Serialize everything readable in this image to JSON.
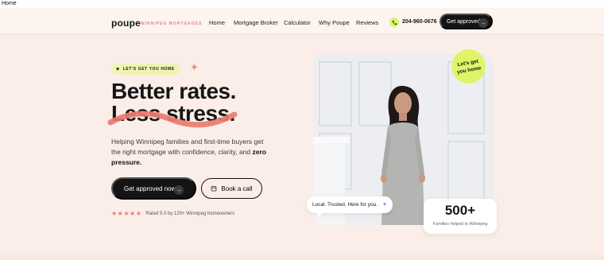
{
  "window": {
    "tab_title": "Home"
  },
  "brand": {
    "name": "poupe",
    "tagline": "WINNIPEG MORTGAGES"
  },
  "nav": {
    "links": [
      "Home",
      "Mortgage Broker",
      "Calculator",
      "Why Poupe",
      "Reviews"
    ],
    "phone": "204-960-0676",
    "cta_label": "Get approved"
  },
  "hero": {
    "eyebrow": "LET'S GET YOU HOME",
    "headline_line1": "Better rates.",
    "headline_line2": "Less stress.",
    "lede": "Helping Winnipeg families and first-time buyers get the right mortgage with confidence, clarity, and",
    "lede_bold": "zero pressure.",
    "primary_cta": "Get approved now",
    "secondary_cta": "Book a call",
    "stars": "★★★★★",
    "rating_text": "Rated 5.0 by 120+ Winnipeg homeowners"
  },
  "photo_card": {
    "badge_line1": "Let's get",
    "badge_line2": "you home",
    "chip_text": "Local. Trusted. Here for you.",
    "stat_value": "500+",
    "stat_label": "Families helped in Winnipeg"
  },
  "colors": {
    "background": "#fbeee8",
    "accent_lime": "#def567",
    "accent_coral": "#ea7b70",
    "dark": "#141414"
  },
  "icons": {
    "phone": "phone-icon",
    "arrow": "arrow-right-icon",
    "calendar": "calendar-icon",
    "heart": "heart-icon",
    "sparkle": "sparkle-icon"
  }
}
